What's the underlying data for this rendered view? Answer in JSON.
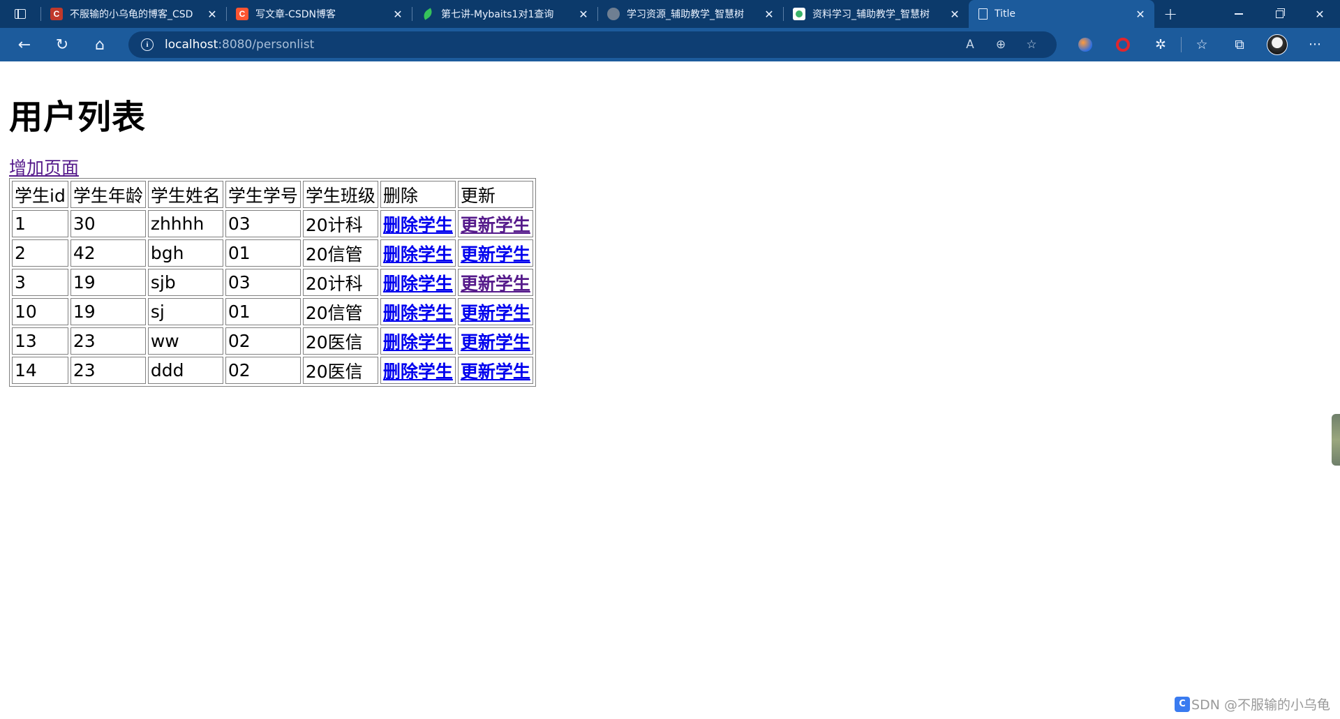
{
  "browser": {
    "tabs": [
      {
        "title": "不服输的小乌龟的博客_CSD",
        "favicon": "csdn-dark"
      },
      {
        "title": "写文章-CSDN博客",
        "favicon": "csdn"
      },
      {
        "title": "第七讲-Mybaits1对1查询",
        "favicon": "leaf"
      },
      {
        "title": "学习资源_辅助教学_智慧树",
        "favicon": "cloud"
      },
      {
        "title": "资料学习_辅助教学_智慧树",
        "favicon": "tree"
      },
      {
        "title": "Title",
        "favicon": "page",
        "active": true
      }
    ],
    "address": {
      "host": "localhost",
      "rest": ":8080/personlist"
    }
  },
  "page": {
    "title": "用户列表",
    "add_link": "增加页面",
    "headers": [
      "学生id",
      "学生年龄",
      "学生姓名",
      "学生学号",
      "学生班级",
      "删除",
      "更新"
    ],
    "rows": [
      {
        "id": "1",
        "age": "30",
        "name": "zhhhh",
        "no": "03",
        "cls": "20计科",
        "del": "删除学生",
        "upd": "更新学生"
      },
      {
        "id": "2",
        "age": "42",
        "name": "bgh",
        "no": "01",
        "cls": "20信管",
        "del": "删除学生",
        "upd": "更新学生"
      },
      {
        "id": "3",
        "age": "19",
        "name": "sjb",
        "no": "03",
        "cls": "20计科",
        "del": "删除学生",
        "upd": "更新学生"
      },
      {
        "id": "10",
        "age": "19",
        "name": "sj",
        "no": "01",
        "cls": "20信管",
        "del": "删除学生",
        "upd": "更新学生"
      },
      {
        "id": "13",
        "age": "23",
        "name": "ww",
        "no": "02",
        "cls": "20医信",
        "del": "删除学生",
        "upd": "更新学生"
      },
      {
        "id": "14",
        "age": "23",
        "name": "ddd",
        "no": "02",
        "cls": "20医信",
        "del": "删除学生",
        "upd": "更新学生"
      }
    ]
  },
  "watermark": {
    "logo": "C",
    "text": "SDN @不服输的小乌龟"
  },
  "colors": {
    "titlebar": "#0c3a6b",
    "toolbar": "#1c5b9c",
    "link": "#0000ee",
    "visited_link": "#551a8b"
  }
}
